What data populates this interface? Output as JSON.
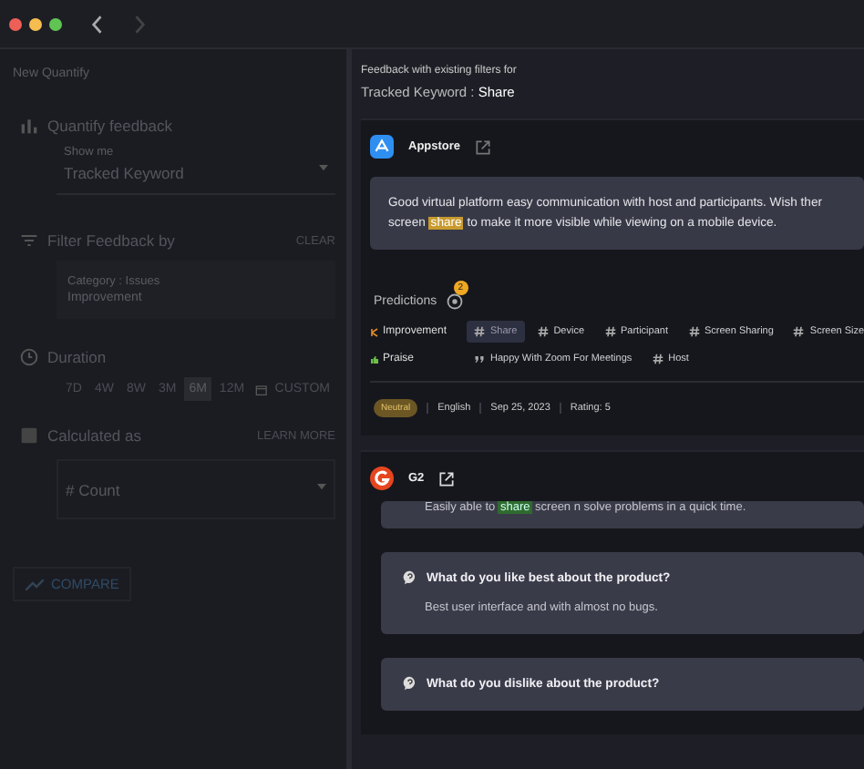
{
  "left_panel": {
    "title": "New Quantify",
    "quantify": {
      "label": "Quantify feedback",
      "field_label": "Show me",
      "value": "Tracked Keyword"
    },
    "filter": {
      "label": "Filter Feedback by",
      "action": "CLEAR",
      "category": "Category : Issues",
      "value": "Improvement"
    },
    "duration": {
      "label": "Duration",
      "periods": [
        {
          "label": "7D",
          "selected": false
        },
        {
          "label": "4W",
          "selected": false
        },
        {
          "label": "8W",
          "selected": false
        },
        {
          "label": "3M",
          "selected": false
        },
        {
          "label": "6M",
          "selected": true
        },
        {
          "label": "12M",
          "selected": false
        }
      ],
      "custom": "CUSTOM"
    },
    "calculated": {
      "label": "Calculated as",
      "action": "LEARN MORE",
      "value": "# Count"
    },
    "compare": "COMPARE"
  },
  "drawer": {
    "subtitle": "Feedback with existing filters for",
    "heading_label": "Tracked Keyword : ",
    "heading_value": "Share",
    "cards": [
      {
        "source": "Appstore",
        "kind": "appstore",
        "quote_lines": [
          {
            "before": "Good virtual platform easy communication with host and participants. Wish ther"
          },
          {
            "before": "screen ",
            "keyword": "share",
            "after": " to make it more visible while viewing on a mobile device."
          }
        ],
        "predictions_label": "Predictions",
        "predictions_count": "2",
        "prediction_rows": [
          {
            "category": "Improvement",
            "kind": "improvement",
            "tags": [
              {
                "label": "Share",
                "selected": true,
                "kind": "hash"
              },
              {
                "label": "Device",
                "selected": false,
                "kind": "hash"
              },
              {
                "label": "Participant",
                "selected": false,
                "kind": "hash"
              },
              {
                "label": "Screen Sharing",
                "selected": false,
                "kind": "hash"
              },
              {
                "label": "Screen Size",
                "selected": false,
                "kind": "hash"
              }
            ]
          },
          {
            "category": "Praise",
            "kind": "praise",
            "tags": [
              {
                "label": "Happy With Zoom For Meetings",
                "selected": false,
                "kind": "quote"
              },
              {
                "label": "Host",
                "selected": false,
                "kind": "hash"
              }
            ]
          }
        ],
        "sentiment": "Neutral",
        "language": "English",
        "date": "Sep 25, 2023",
        "rating": "Rating: 5"
      },
      {
        "source": "G2",
        "kind": "g2",
        "answers": [
          {
            "answer_before": "Easily able to ",
            "keyword": "share",
            "answer_after": " screen n solve problems in a quick time."
          },
          {
            "question": "What do you like best about the product?",
            "answer_before": "Best user interface and with almost no bugs."
          },
          {
            "question": "What do you dislike about the product?"
          }
        ]
      }
    ]
  }
}
